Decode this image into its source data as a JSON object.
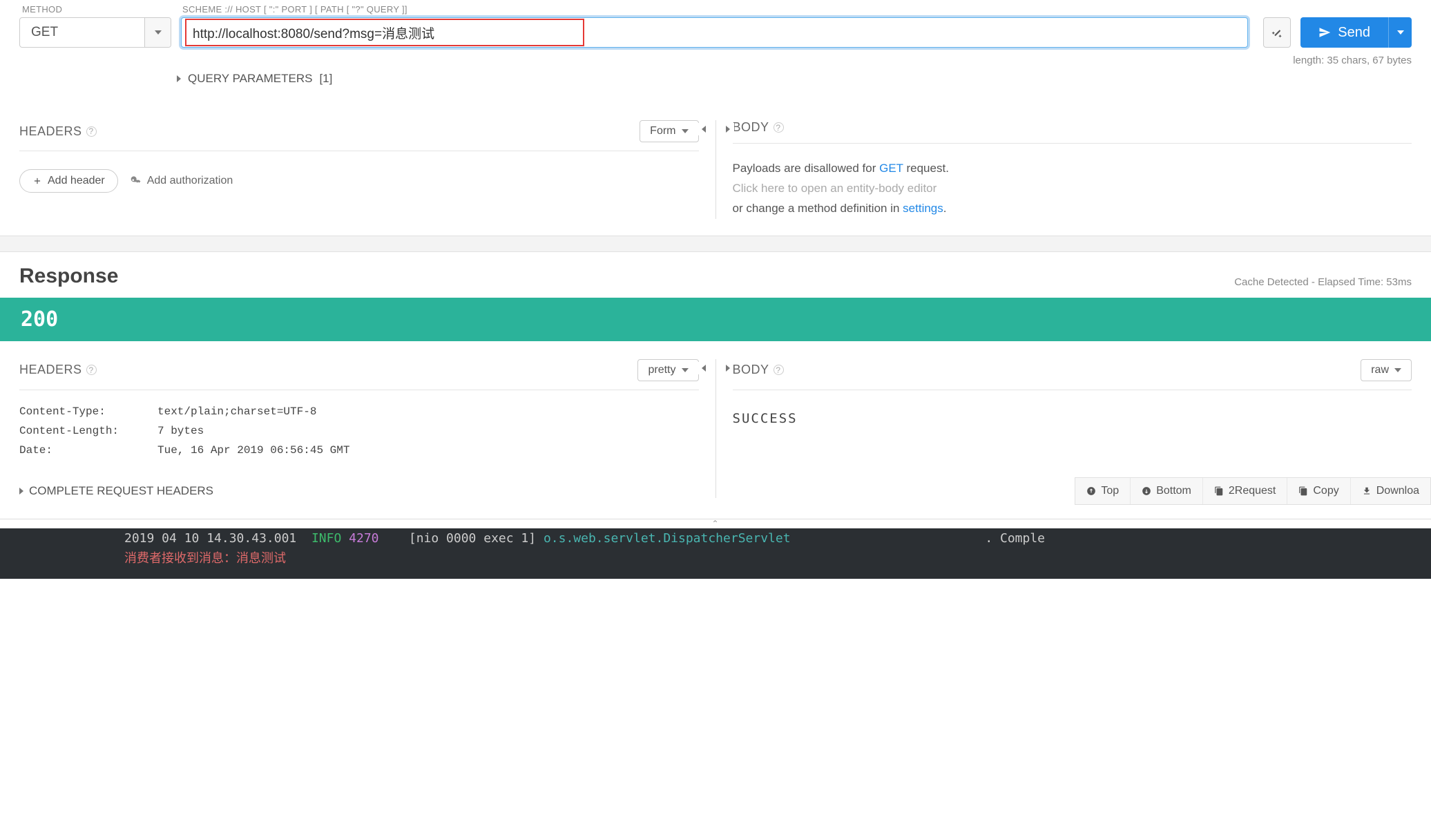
{
  "request": {
    "method_label": "METHOD",
    "url_label": "SCHEME :// HOST [ \":\" PORT ] [ PATH [ \"?\" QUERY ]]",
    "method": "GET",
    "url": "http://localhost:8080/send?msg=消息测试",
    "length_info": "length: 35 chars, 67 bytes",
    "send_label": "Send",
    "query_params_label": "QUERY PARAMETERS",
    "query_params_count": "[1]",
    "headers_title": "HEADERS",
    "headers_mode": "Form",
    "add_header_label": "Add header",
    "add_auth_label": "Add authorization",
    "body_title": "BODY",
    "body_msg_prefix": "Payloads are disallowed for ",
    "body_msg_method": "GET",
    "body_msg_suffix": " request.",
    "body_msg_line2": "Click here to open an entity-body editor",
    "body_msg_line3a": "or change a method definition in ",
    "body_msg_settings": "settings",
    "body_msg_line3b": "."
  },
  "response": {
    "title": "Response",
    "meta": "Cache Detected - Elapsed Time: 53ms",
    "status": "200",
    "headers_title": "HEADERS",
    "headers_mode": "pretty",
    "body_title": "BODY",
    "body_mode": "raw",
    "headers": [
      {
        "key": "Content-Type:",
        "val": "text/plain;charset=UTF-8"
      },
      {
        "key": "Content-Length:",
        "val": "7 bytes"
      },
      {
        "key": "Date:",
        "val": "Tue, 16 Apr 2019 06:56:45 GMT"
      }
    ],
    "complete_headers_label": "COMPLETE REQUEST HEADERS",
    "body_content": "SUCCESS",
    "toolbar": {
      "top": "Top",
      "bottom": "Bottom",
      "to_request": "2Request",
      "copy": "Copy",
      "download": "Downloa"
    }
  },
  "terminal": {
    "line1_a": "2019 04 10 14.30.43.001",
    "line1_b": "INFO",
    "line1_c": "4270",
    "line1_d": "[nio 0000 exec 1]",
    "line1_e": "o.s.web.servlet.DispatcherServlet",
    "line1_f": ". Comple",
    "line2": "消费者接收到消息：消息测试"
  }
}
